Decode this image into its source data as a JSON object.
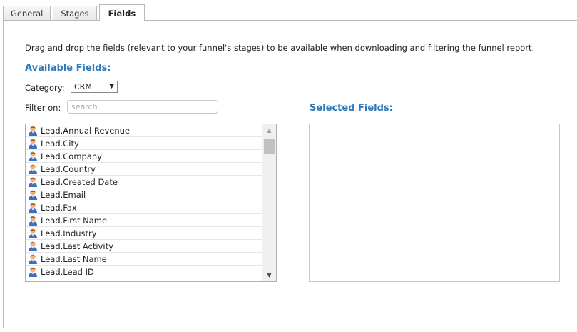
{
  "tabs": [
    {
      "label": "General",
      "active": false
    },
    {
      "label": "Stages",
      "active": false
    },
    {
      "label": "Fields",
      "active": true
    }
  ],
  "instructions": "Drag and drop the fields (relevant to your funnel's stages) to be available when downloading and filtering the funnel report.",
  "available": {
    "title": "Available Fields:",
    "category_label": "Category:",
    "category_value": "CRM",
    "filter_label": "Filter on:",
    "filter_value": "",
    "filter_placeholder": "search",
    "fields": [
      "Lead.Annual Revenue",
      "Lead.City",
      "Lead.Company",
      "Lead.Country",
      "Lead.Created Date",
      "Lead.Email",
      "Lead.Fax",
      "Lead.First Name",
      "Lead.Industry",
      "Lead.Last Activity",
      "Lead.Last Name",
      "Lead.Lead ID"
    ],
    "field_icon": "user-icon"
  },
  "selected": {
    "title": "Selected Fields:",
    "fields": []
  },
  "colors": {
    "section_title": "#2f79b8",
    "border": "#b9b9b9"
  }
}
